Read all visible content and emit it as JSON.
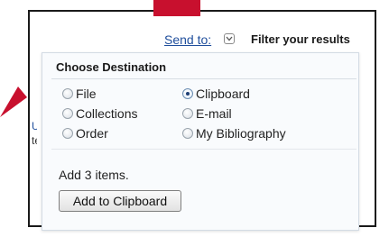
{
  "header": {
    "send_to_label": "Send to:",
    "filter_label": "Filter your results"
  },
  "choose_destination": {
    "title": "Choose Destination",
    "options": [
      {
        "label": "File",
        "checked": false
      },
      {
        "label": "Collections",
        "checked": false
      },
      {
        "label": "Order",
        "checked": false
      },
      {
        "label": "Clipboard",
        "checked": true
      },
      {
        "label": "E-mail",
        "checked": false
      },
      {
        "label": "My Bibliography",
        "checked": false
      }
    ],
    "items_text": "Add 3 items.",
    "action_button": "Add to Clipboard"
  },
  "background_fragments": [
    "U",
    "te"
  ],
  "colors": {
    "annotation_arrow": "#c8102e",
    "link": "#1f4e9c"
  },
  "icons": {
    "dropdown": "chevron-down-icon"
  }
}
